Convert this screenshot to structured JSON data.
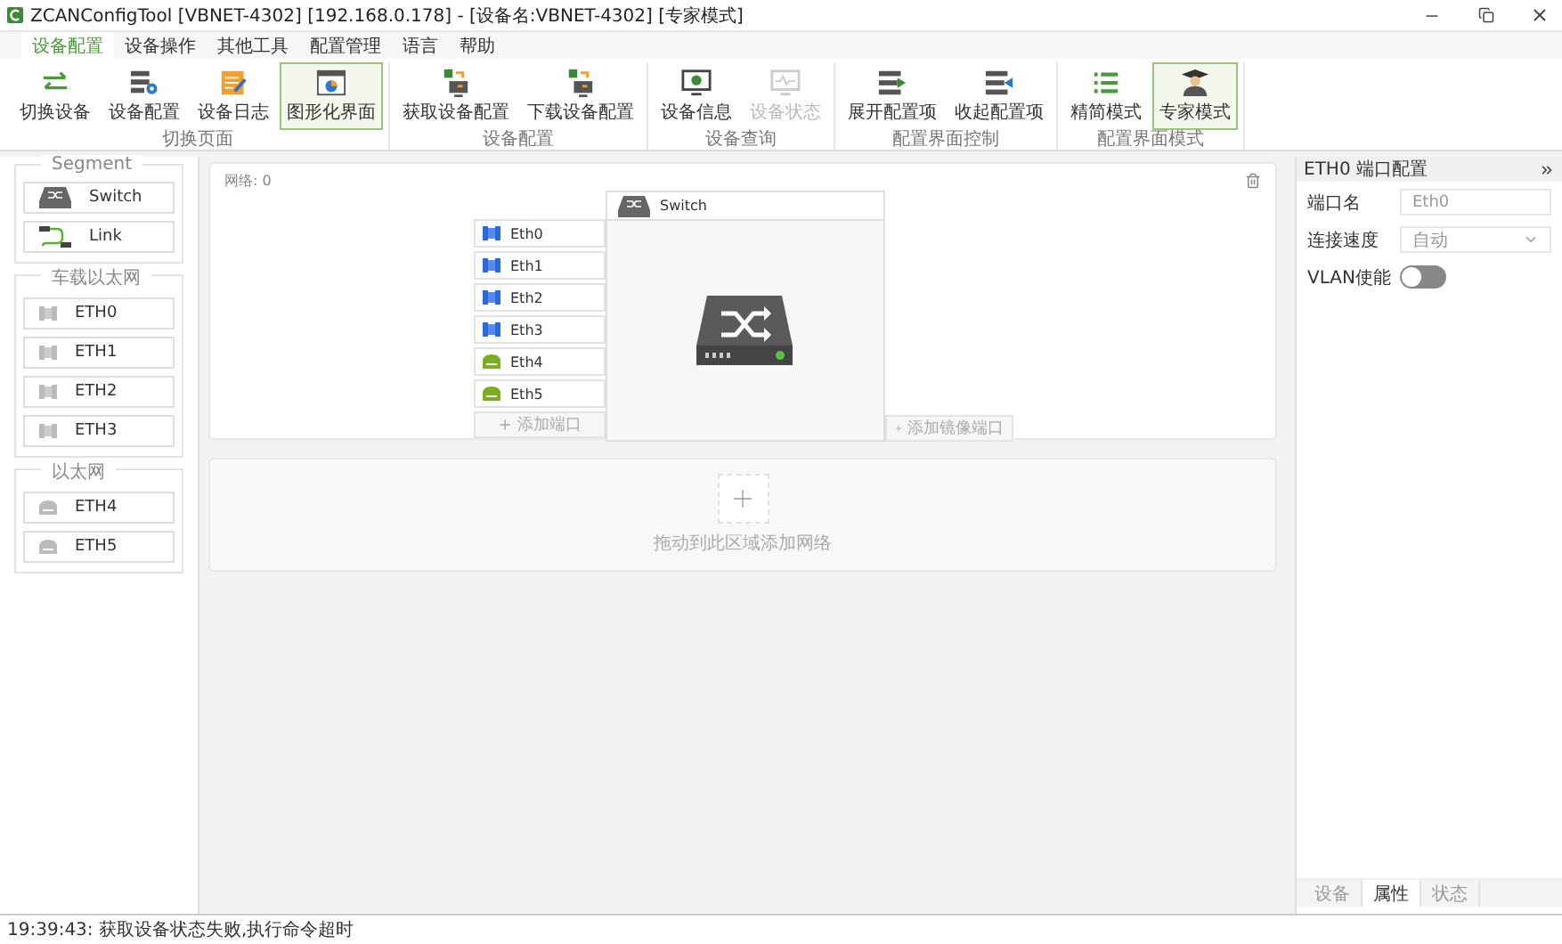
{
  "window": {
    "title": "ZCANConfigTool [VBNET-4302] [192.168.0.178] - [设备名:VBNET-4302] [专家模式]"
  },
  "menu": [
    {
      "label": "设备配置",
      "selected": true
    },
    {
      "label": "设备操作",
      "selected": false
    },
    {
      "label": "其他工具",
      "selected": false
    },
    {
      "label": "配置管理",
      "selected": false
    },
    {
      "label": "语言",
      "selected": false
    },
    {
      "label": "帮助",
      "selected": false
    }
  ],
  "ribbon": [
    {
      "label": "切换页面",
      "buttons": [
        {
          "label": "切换设备",
          "selected": false,
          "disabled": false
        },
        {
          "label": "设备配置",
          "selected": false,
          "disabled": false
        },
        {
          "label": "设备日志",
          "selected": false,
          "disabled": false
        },
        {
          "label": "图形化界面",
          "selected": true,
          "disabled": false
        }
      ]
    },
    {
      "label": "设备配置",
      "buttons": [
        {
          "label": "获取设备配置",
          "selected": false,
          "disabled": false
        },
        {
          "label": "下载设备配置",
          "selected": false,
          "disabled": false
        }
      ]
    },
    {
      "label": "设备查询",
      "buttons": [
        {
          "label": "设备信息",
          "selected": false,
          "disabled": false
        },
        {
          "label": "设备状态",
          "selected": false,
          "disabled": true
        }
      ]
    },
    {
      "label": "配置界面控制",
      "buttons": [
        {
          "label": "展开配置项",
          "selected": false,
          "disabled": false
        },
        {
          "label": "收起配置项",
          "selected": false,
          "disabled": false
        }
      ]
    },
    {
      "label": "配置界面模式",
      "buttons": [
        {
          "label": "精简模式",
          "selected": false,
          "disabled": false
        },
        {
          "label": "专家模式",
          "selected": true,
          "disabled": false
        }
      ]
    }
  ],
  "palette": [
    {
      "title": "Segment",
      "items": [
        {
          "label": "Switch",
          "kind": "switch"
        },
        {
          "label": "Link",
          "kind": "link"
        }
      ]
    },
    {
      "title": "车载以太网",
      "items": [
        {
          "label": "ETH0",
          "kind": "automotive"
        },
        {
          "label": "ETH1",
          "kind": "automotive"
        },
        {
          "label": "ETH2",
          "kind": "automotive"
        },
        {
          "label": "ETH3",
          "kind": "automotive"
        }
      ]
    },
    {
      "title": "以太网",
      "items": [
        {
          "label": "ETH4",
          "kind": "ethernet"
        },
        {
          "label": "ETH5",
          "kind": "ethernet"
        }
      ]
    }
  ],
  "network": {
    "label": "网络: 0",
    "ports": [
      {
        "label": "Eth0",
        "kind": "automotive"
      },
      {
        "label": "Eth1",
        "kind": "automotive"
      },
      {
        "label": "Eth2",
        "kind": "automotive"
      },
      {
        "label": "Eth3",
        "kind": "automotive"
      },
      {
        "label": "Eth4",
        "kind": "ethernet"
      },
      {
        "label": "Eth5",
        "kind": "ethernet"
      }
    ],
    "add_port": "添加端口",
    "switch_title": "Switch",
    "add_mirror_port": "添加镜像端口"
  },
  "drop_zone": {
    "hint": "拖动到此区域添加网络"
  },
  "properties": {
    "title": "ETH0 端口配置",
    "fields": [
      {
        "kind": "text",
        "label": "端口名",
        "value": "Eth0"
      },
      {
        "kind": "select",
        "label": "连接速度",
        "value": "自动"
      },
      {
        "kind": "toggle",
        "label": "VLAN使能",
        "on": false
      }
    ],
    "tabs": [
      {
        "label": "设备",
        "selected": false
      },
      {
        "label": "属性",
        "selected": true
      },
      {
        "label": "状态",
        "selected": false
      }
    ]
  },
  "status_bar": "19:39:43: 获取设备状态失败,执行命令超时"
}
